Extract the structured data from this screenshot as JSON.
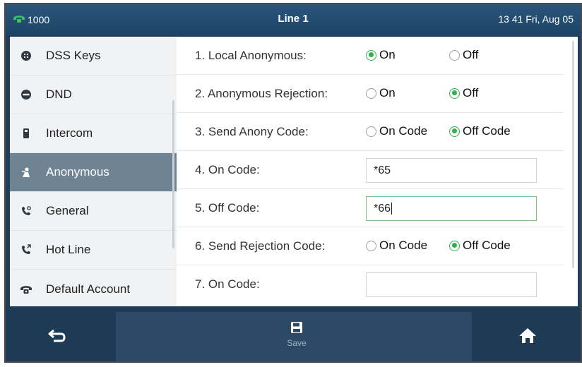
{
  "status": {
    "extension": "1000",
    "title": "Line 1",
    "datetime": "13 41 Fri, Aug 05"
  },
  "sidebar": {
    "items": [
      {
        "label": "DSS Keys",
        "icon": "dss-keys-icon"
      },
      {
        "label": "DND",
        "icon": "dnd-icon"
      },
      {
        "label": "Intercom",
        "icon": "intercom-icon"
      },
      {
        "label": "Anonymous",
        "icon": "anonymous-icon",
        "active": true
      },
      {
        "label": "General",
        "icon": "general-icon"
      },
      {
        "label": "Hot Line",
        "icon": "hot-line-icon"
      },
      {
        "label": "Default Account",
        "icon": "default-account-icon"
      }
    ]
  },
  "settings": {
    "local_anonymous": {
      "label": "1. Local Anonymous:",
      "on": "On",
      "off": "Off",
      "selected": "On"
    },
    "anonymous_rejection": {
      "label": "2. Anonymous Rejection:",
      "on": "On",
      "off": "Off",
      "selected": "Off"
    },
    "send_anony_code": {
      "label": "3. Send Anony Code:",
      "on": "On Code",
      "off": "Off Code",
      "selected": "Off Code"
    },
    "on_code": {
      "label": "4. On Code:",
      "value": "*65"
    },
    "off_code": {
      "label": "5. Off Code:",
      "value": "*66"
    },
    "send_rejection_code": {
      "label": "6. Send Rejection Code:",
      "on": "On Code",
      "off": "Off Code",
      "selected": "Off Code"
    },
    "rejection_on_code": {
      "label": "7. On Code:",
      "value": ""
    }
  },
  "softkeys": {
    "back_icon": "back-arrow-icon",
    "save_label": "Save",
    "save_icon": "save-icon",
    "home_icon": "home-icon"
  },
  "colors": {
    "accent_green": "#2fb24c",
    "active_item": "#6e8495",
    "bar_dark": "#1e3b55"
  }
}
